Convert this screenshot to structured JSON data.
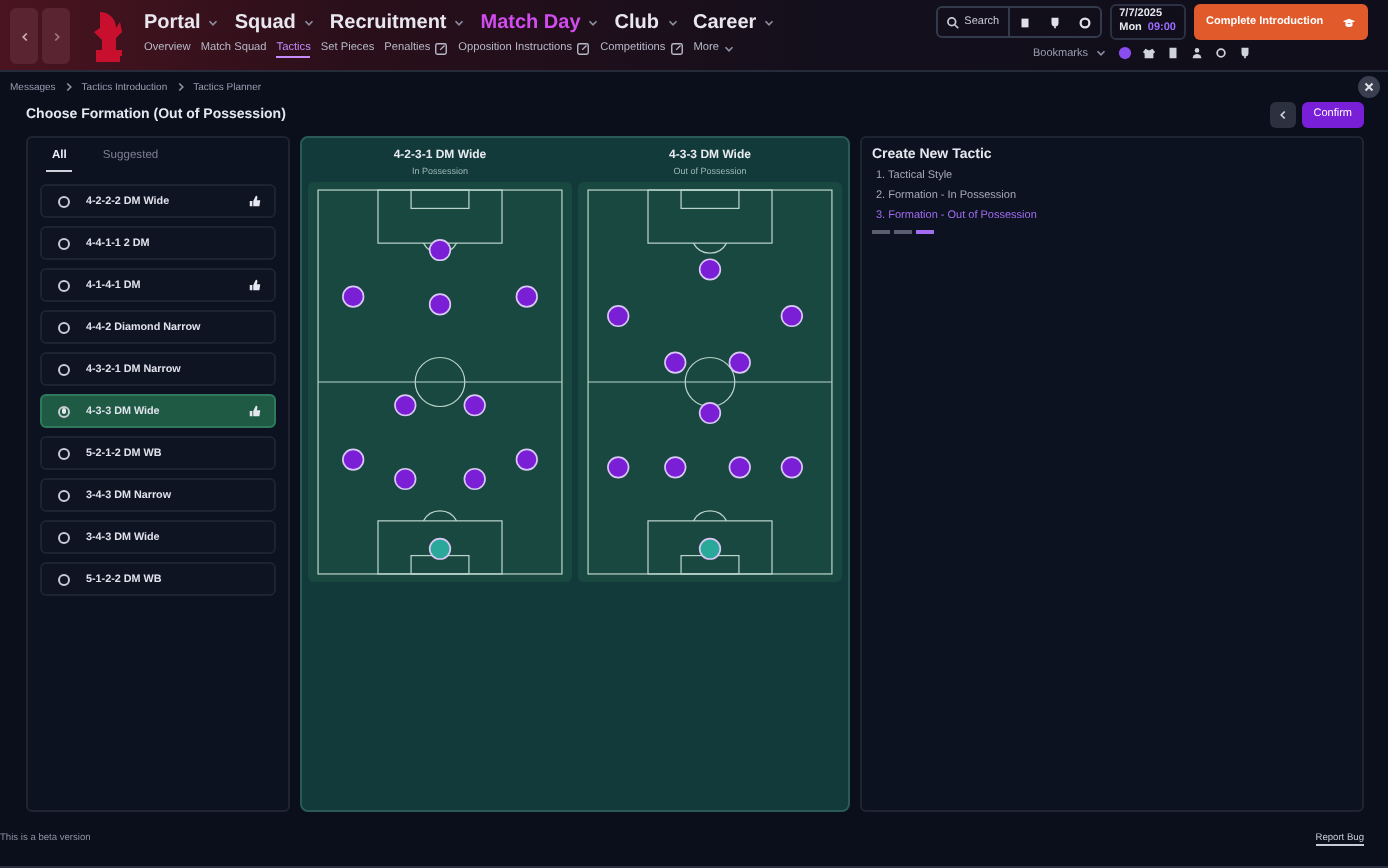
{
  "nav": {
    "menus": [
      {
        "label": "Portal",
        "selected": false
      },
      {
        "label": "Squad",
        "selected": false
      },
      {
        "label": "Recruitment",
        "selected": false
      },
      {
        "label": "Match Day",
        "selected": true
      },
      {
        "label": "Club",
        "selected": false
      },
      {
        "label": "Career",
        "selected": false
      }
    ],
    "subnav": [
      {
        "label": "Overview",
        "selected": false,
        "external": false
      },
      {
        "label": "Match Squad",
        "selected": false,
        "external": false
      },
      {
        "label": "Tactics",
        "selected": true,
        "external": false
      },
      {
        "label": "Set Pieces",
        "selected": false,
        "external": false
      },
      {
        "label": "Penalties",
        "selected": false,
        "external": true
      },
      {
        "label": "Opposition Instructions",
        "selected": false,
        "external": true
      },
      {
        "label": "Competitions",
        "selected": false,
        "external": true
      }
    ],
    "more": "More",
    "search": "Search",
    "date": "7/7/2025",
    "day": "Mon",
    "time": "09:00",
    "cta": "Complete Introduction",
    "bookmarks": "Bookmarks"
  },
  "breadcrumb": [
    "Messages",
    "Tactics Introduction",
    "Tactics Planner"
  ],
  "title": "Choose Formation (Out of Possession)",
  "confirm": "Confirm",
  "tabs": [
    {
      "label": "All",
      "selected": true
    },
    {
      "label": "Suggested",
      "selected": false
    }
  ],
  "formations": [
    {
      "name": "4-2-2-2 DM Wide",
      "selected": false,
      "flagged": true
    },
    {
      "name": "4-4-1-1 2 DM",
      "selected": false,
      "flagged": false
    },
    {
      "name": "4-1-4-1 DM",
      "selected": false,
      "flagged": true
    },
    {
      "name": "4-4-2 Diamond Narrow",
      "selected": false,
      "flagged": false
    },
    {
      "name": "4-3-2-1 DM Narrow",
      "selected": false,
      "flagged": false
    },
    {
      "name": "4-3-3 DM Wide",
      "selected": true,
      "flagged": true
    },
    {
      "name": "5-2-1-2 DM WB",
      "selected": false,
      "flagged": false
    },
    {
      "name": "3-4-3 DM Narrow",
      "selected": false,
      "flagged": false
    },
    {
      "name": "3-4-3 DM Wide",
      "selected": false,
      "flagged": false
    },
    {
      "name": "5-1-2-2 DM WB",
      "selected": false,
      "flagged": false
    }
  ],
  "pitches": [
    {
      "title": "4-2-3-1 DM Wide",
      "subtitle": "In Possession"
    },
    {
      "title": "4-3-3 DM Wide",
      "subtitle": "Out of Possession"
    }
  ],
  "steps_title": "Create New Tactic",
  "steps": [
    {
      "label": "1. Tactical Style",
      "selected": false
    },
    {
      "label": "2. Formation - In Possession",
      "selected": false
    },
    {
      "label": "3. Formation - Out of Possession",
      "selected": true
    }
  ],
  "footer": {
    "note": "This is a beta version",
    "report": "Report Bug"
  }
}
